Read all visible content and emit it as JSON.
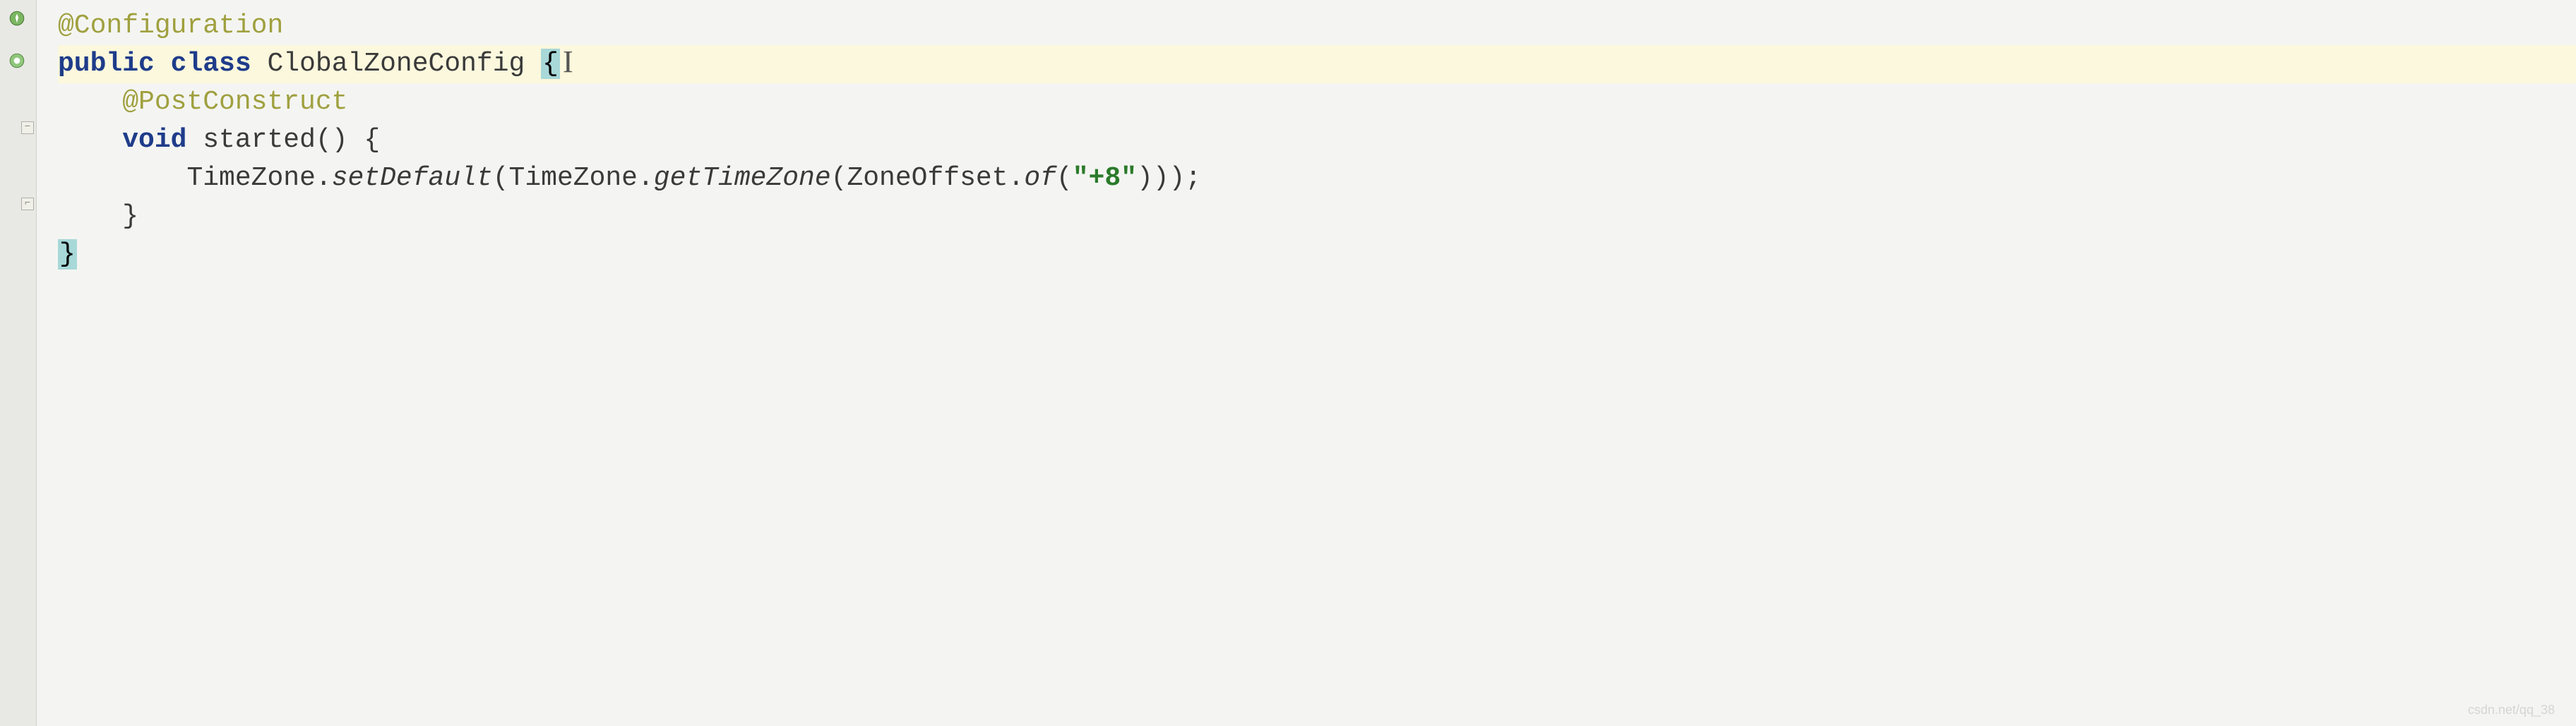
{
  "code": {
    "line1": {
      "annotation": "@Configuration"
    },
    "line2": {
      "kw_public": "public",
      "kw_class": "class",
      "class_name": "ClobalZoneConfig",
      "brace_open": "{"
    },
    "line3": {
      "annotation": "@PostConstruct"
    },
    "line4": {
      "kw_void": "void",
      "method_name": "started",
      "parens": "()",
      "brace_open": "{"
    },
    "line5": {
      "tz_class": "TimeZone",
      "dot1": ".",
      "setDefault": "setDefault",
      "paren_open1": "(",
      "tz_class2": "TimeZone",
      "dot2": ".",
      "getTimeZone": "getTimeZone",
      "paren_open2": "(",
      "zoneOffset": "ZoneOffset",
      "dot3": ".",
      "of": "of",
      "paren_open3": "(",
      "string_val": "\"+8\"",
      "close": ")));"
    },
    "line6": {
      "brace_close": "}"
    },
    "line7": {
      "brace_close": "}"
    }
  },
  "cursor_glyph": "I",
  "watermark": "csdn.net/qq_38"
}
